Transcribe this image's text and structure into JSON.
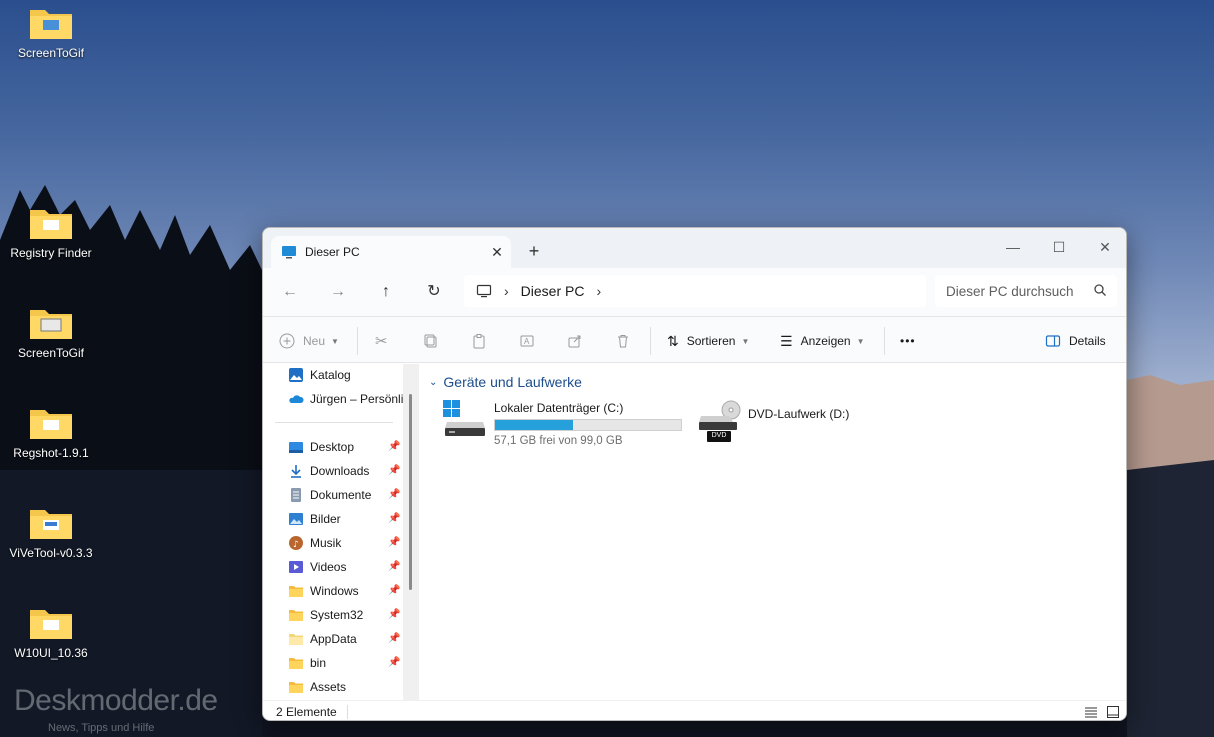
{
  "desktop": {
    "icons": [
      {
        "label": "ScreenToGif"
      },
      {
        "label": "Registry Finder"
      },
      {
        "label": "ScreenToGif"
      },
      {
        "label": "Regshot-1.9.1"
      },
      {
        "label": "ViVeTool-v0.3.3"
      },
      {
        "label": "W10UI_10.36"
      }
    ],
    "watermark": "Deskmodder.de",
    "watermark_sub": "News, Tipps und Hilfe"
  },
  "window": {
    "tab_title": "Dieser PC",
    "new_tab_label": "+",
    "address": {
      "location": "Dieser PC"
    },
    "search": {
      "placeholder": "Dieser PC durchsuch"
    },
    "toolbar": {
      "new_label": "Neu",
      "sort_label": "Sortieren",
      "view_label": "Anzeigen",
      "more_label": "•••",
      "details_label": "Details"
    },
    "sidebar": {
      "items": [
        {
          "label": "Katalog",
          "icon": "gallery-icon"
        },
        {
          "label": "Jürgen – Persönlic",
          "icon": "onedrive-icon"
        },
        {
          "label": "Desktop",
          "icon": "desktop-folder-icon",
          "pinned": true
        },
        {
          "label": "Downloads",
          "icon": "download-icon",
          "pinned": true
        },
        {
          "label": "Dokumente",
          "icon": "documents-icon",
          "pinned": true
        },
        {
          "label": "Bilder",
          "icon": "pictures-icon",
          "pinned": true
        },
        {
          "label": "Musik",
          "icon": "music-icon",
          "pinned": true
        },
        {
          "label": "Videos",
          "icon": "videos-icon",
          "pinned": true
        },
        {
          "label": "Windows",
          "icon": "folder-icon",
          "pinned": true
        },
        {
          "label": "System32",
          "icon": "folder-icon",
          "pinned": true
        },
        {
          "label": "AppData",
          "icon": "folder-icon",
          "pinned": true
        },
        {
          "label": "bin",
          "icon": "folder-icon",
          "pinned": true
        },
        {
          "label": "Assets",
          "icon": "folder-icon",
          "pinned": false
        }
      ]
    },
    "content": {
      "group_title": "Geräte und Laufwerke",
      "drives": [
        {
          "name": "Lokaler Datenträger (C:)",
          "free_text": "57,1 GB frei von 99,0 GB",
          "used_fraction": 0.42
        },
        {
          "name": "DVD-Laufwerk (D:)",
          "badge": "DVD"
        }
      ]
    },
    "status": {
      "count_text": "2 Elemente"
    },
    "colors": {
      "accent": "#26a0da",
      "group_header": "#1e4e8c"
    }
  }
}
